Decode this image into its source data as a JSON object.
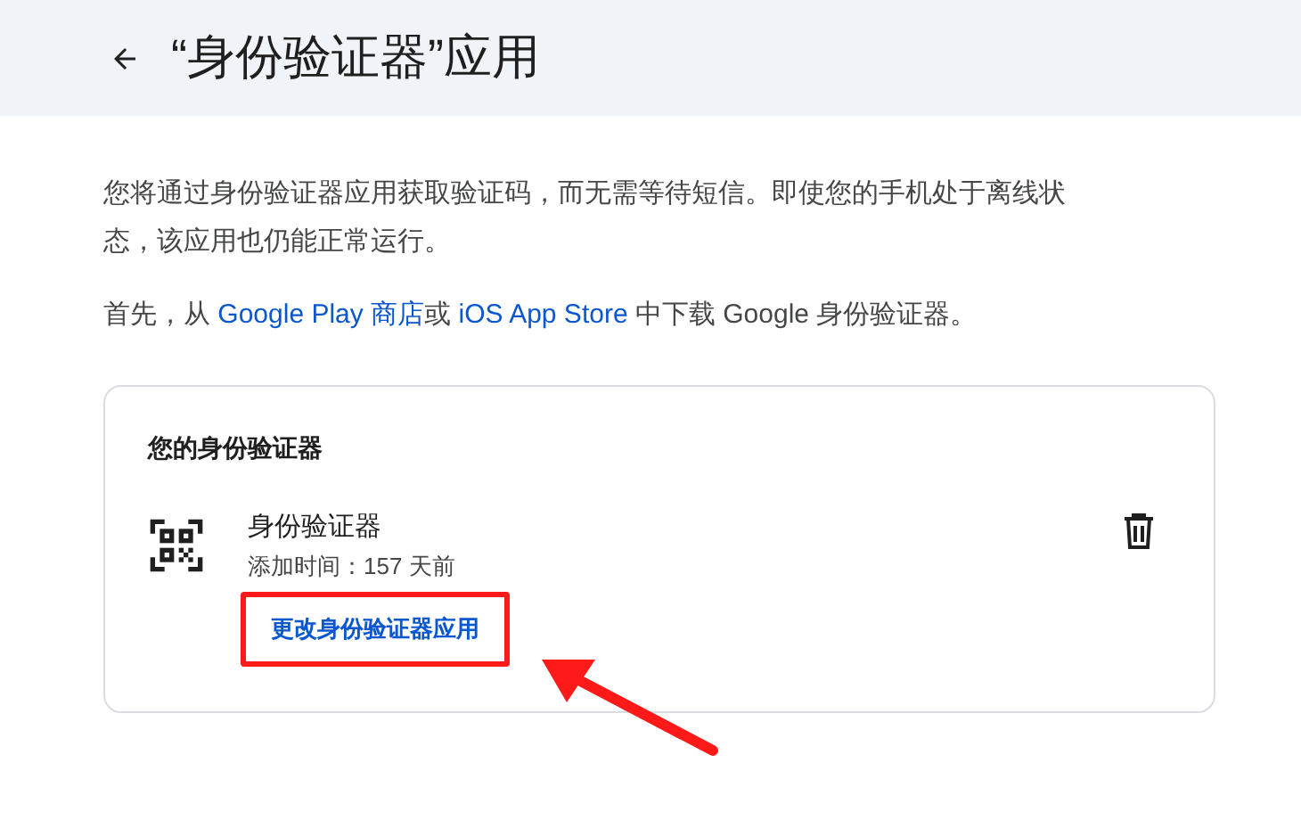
{
  "header": {
    "title": "“身份验证器”应用"
  },
  "intro": {
    "text": "您将通过身份验证器应用获取验证码，而无需等待短信。即使您的手机处于离线状态，该应用也仍能正常运行。"
  },
  "download": {
    "segments": [
      {
        "kind": "text",
        "text": "首先，从 "
      },
      {
        "kind": "link",
        "text": "Google Play 商店"
      },
      {
        "kind": "text",
        "text": "或 "
      },
      {
        "kind": "link",
        "text": "iOS App Store"
      },
      {
        "kind": "text",
        "text": " 中下载 Google 身份验证器。"
      }
    ]
  },
  "card": {
    "heading": "您的身份验证器",
    "authenticator": {
      "name": "身份验证器",
      "added": "添加时间：157 天前"
    },
    "change_link": "更改身份验证器应用",
    "highlighted": true
  }
}
